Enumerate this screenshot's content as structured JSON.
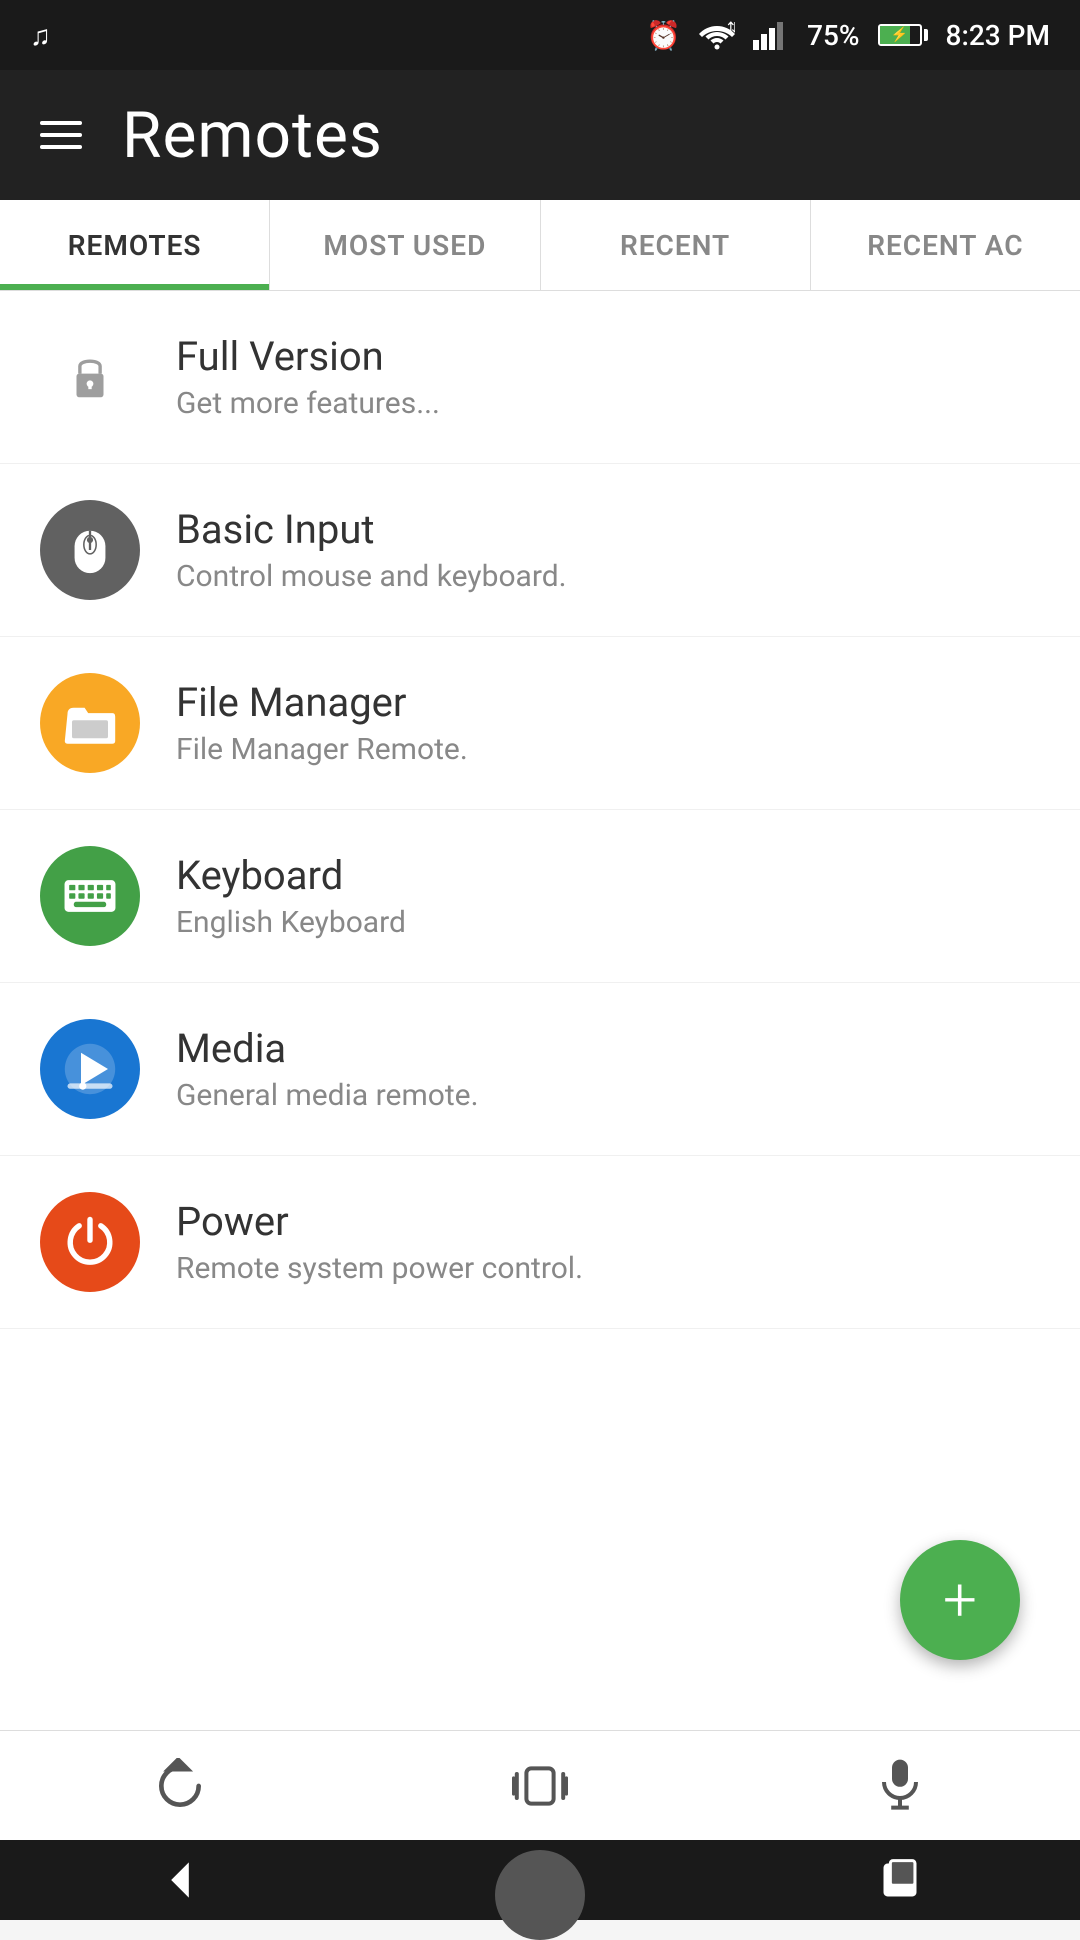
{
  "statusBar": {
    "time": "8:23 PM",
    "battery": "75%",
    "icons": {
      "music": "♪",
      "alarm": "⏰",
      "wifi": "wifi-icon",
      "signal": "signal-icon",
      "battery": "battery-icon",
      "charging": "charging-icon"
    }
  },
  "header": {
    "title": "Remotes",
    "menuIcon": "menu-icon"
  },
  "tabs": [
    {
      "id": "remotes",
      "label": "REMOTES",
      "active": true
    },
    {
      "id": "most-used",
      "label": "MOST USED",
      "active": false
    },
    {
      "id": "recent",
      "label": "RECENT",
      "active": false
    },
    {
      "id": "recent-ac",
      "label": "RECENT AC",
      "active": false
    }
  ],
  "listItems": [
    {
      "id": "full-version",
      "title": "Full Version",
      "subtitle": "Get more features...",
      "iconColor": "#9e9e9e",
      "iconType": "lock"
    },
    {
      "id": "basic-input",
      "title": "Basic Input",
      "subtitle": "Control mouse and keyboard.",
      "iconColor": "#616161",
      "iconType": "mouse"
    },
    {
      "id": "file-manager",
      "title": "File Manager",
      "subtitle": "File Manager Remote.",
      "iconColor": "#f9a825",
      "iconType": "folder"
    },
    {
      "id": "keyboard",
      "title": "Keyboard",
      "subtitle": "English Keyboard",
      "iconColor": "#43a047",
      "iconType": "keyboard"
    },
    {
      "id": "media",
      "title": "Media",
      "subtitle": "General media remote.",
      "iconColor": "#1976d2",
      "iconType": "media"
    },
    {
      "id": "power",
      "title": "Power",
      "subtitle": "Remote system power control.",
      "iconColor": "#e64a19",
      "iconType": "power"
    }
  ],
  "fab": {
    "label": "+",
    "action": "add-remote"
  },
  "bottomBar": {
    "refreshLabel": "refresh",
    "vibrateLabel": "vibrate",
    "micLabel": "microphone"
  },
  "navBar": {
    "backLabel": "back",
    "homeLabel": "home",
    "recentLabel": "recent-apps"
  }
}
